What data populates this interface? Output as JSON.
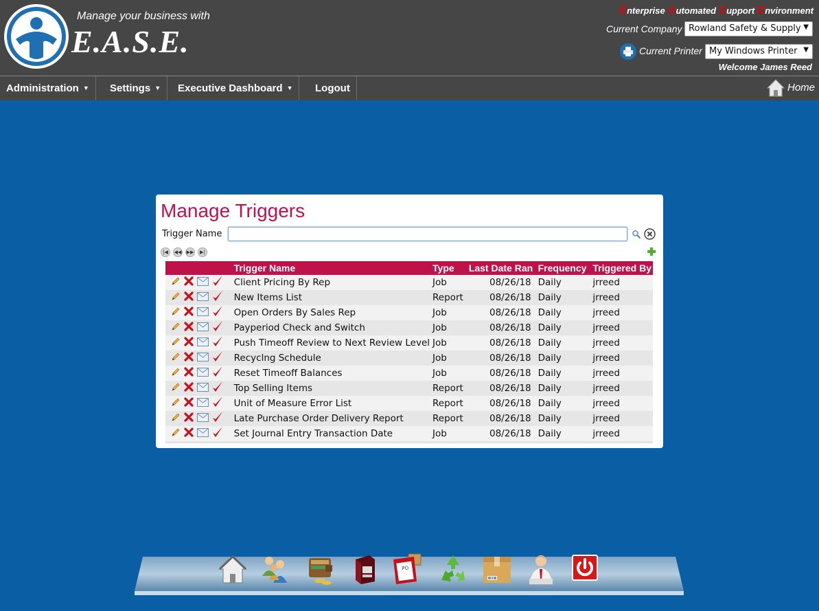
{
  "header": {
    "tagline": "Manage your business with",
    "brand": "E.A.S.E.",
    "ease_words": [
      {
        "cap": "E",
        "rest": "nterprise"
      },
      {
        "cap": "A",
        "rest": "utomated"
      },
      {
        "cap": "S",
        "rest": "upport"
      },
      {
        "cap": "E",
        "rest": "nvironment"
      }
    ],
    "company_label": "Current Company",
    "company_value": "Rowland Safety & Supply",
    "printer_label": "Current Printer",
    "printer_value": "My Windows Printer",
    "welcome": "Welcome James Reed"
  },
  "nav": {
    "items": [
      {
        "label": "Administration",
        "dropdown": true
      },
      {
        "label": "Settings",
        "dropdown": true
      },
      {
        "label": "Executive Dashboard",
        "dropdown": true
      },
      {
        "label": "Logout",
        "dropdown": false
      }
    ],
    "home": "Home"
  },
  "panel": {
    "title": "Manage Triggers",
    "filter_label": "Trigger Name",
    "filter_value": "",
    "columns": [
      "Trigger Name",
      "Type",
      "Last Date Ran",
      "Frequency",
      "Triggered By"
    ],
    "rows": [
      {
        "name": "Client Pricing By Rep",
        "type": "Job",
        "last": "08/26/18",
        "freq": "Daily",
        "by": "jrreed"
      },
      {
        "name": "New Items List",
        "type": "Report",
        "last": "08/26/18",
        "freq": "Daily",
        "by": "jrreed"
      },
      {
        "name": "Open Orders By Sales Rep",
        "type": "Job",
        "last": "08/26/18",
        "freq": "Daily",
        "by": "jrreed"
      },
      {
        "name": "Payperiod Check and Switch",
        "type": "Job",
        "last": "08/26/18",
        "freq": "Daily",
        "by": "jrreed"
      },
      {
        "name": "Push Timeoff Review to Next Review Level",
        "type": "Job",
        "last": "08/26/18",
        "freq": "Daily",
        "by": "jrreed"
      },
      {
        "name": "Recyclng Schedule",
        "type": "Job",
        "last": "08/26/18",
        "freq": "Daily",
        "by": "jrreed"
      },
      {
        "name": "Reset Timeoff Balances",
        "type": "Job",
        "last": "08/26/18",
        "freq": "Daily",
        "by": "jrreed"
      },
      {
        "name": "Top Selling Items",
        "type": "Report",
        "last": "08/26/18",
        "freq": "Daily",
        "by": "jrreed"
      },
      {
        "name": "Unit of Measure Error List",
        "type": "Report",
        "last": "08/26/18",
        "freq": "Daily",
        "by": "jrreed"
      },
      {
        "name": "Late Purchase Order Delivery Report",
        "type": "Report",
        "last": "08/26/18",
        "freq": "Daily",
        "by": "jrreed"
      },
      {
        "name": "Set Journal Entry Transaction Date",
        "type": "Job",
        "last": "08/26/18",
        "freq": "Daily",
        "by": "jrreed"
      }
    ]
  },
  "dock": {
    "icons": [
      "home-icon",
      "users-icon",
      "wallet-icon",
      "product-box-icon",
      "purchase-order-icon",
      "recycle-icon",
      "package-icon",
      "employee-icon",
      "power-icon"
    ]
  },
  "colors": {
    "background": "#0a5ea3",
    "header": "#464646",
    "accent": "#c0124a",
    "ease_capital": "#d10a0a"
  }
}
